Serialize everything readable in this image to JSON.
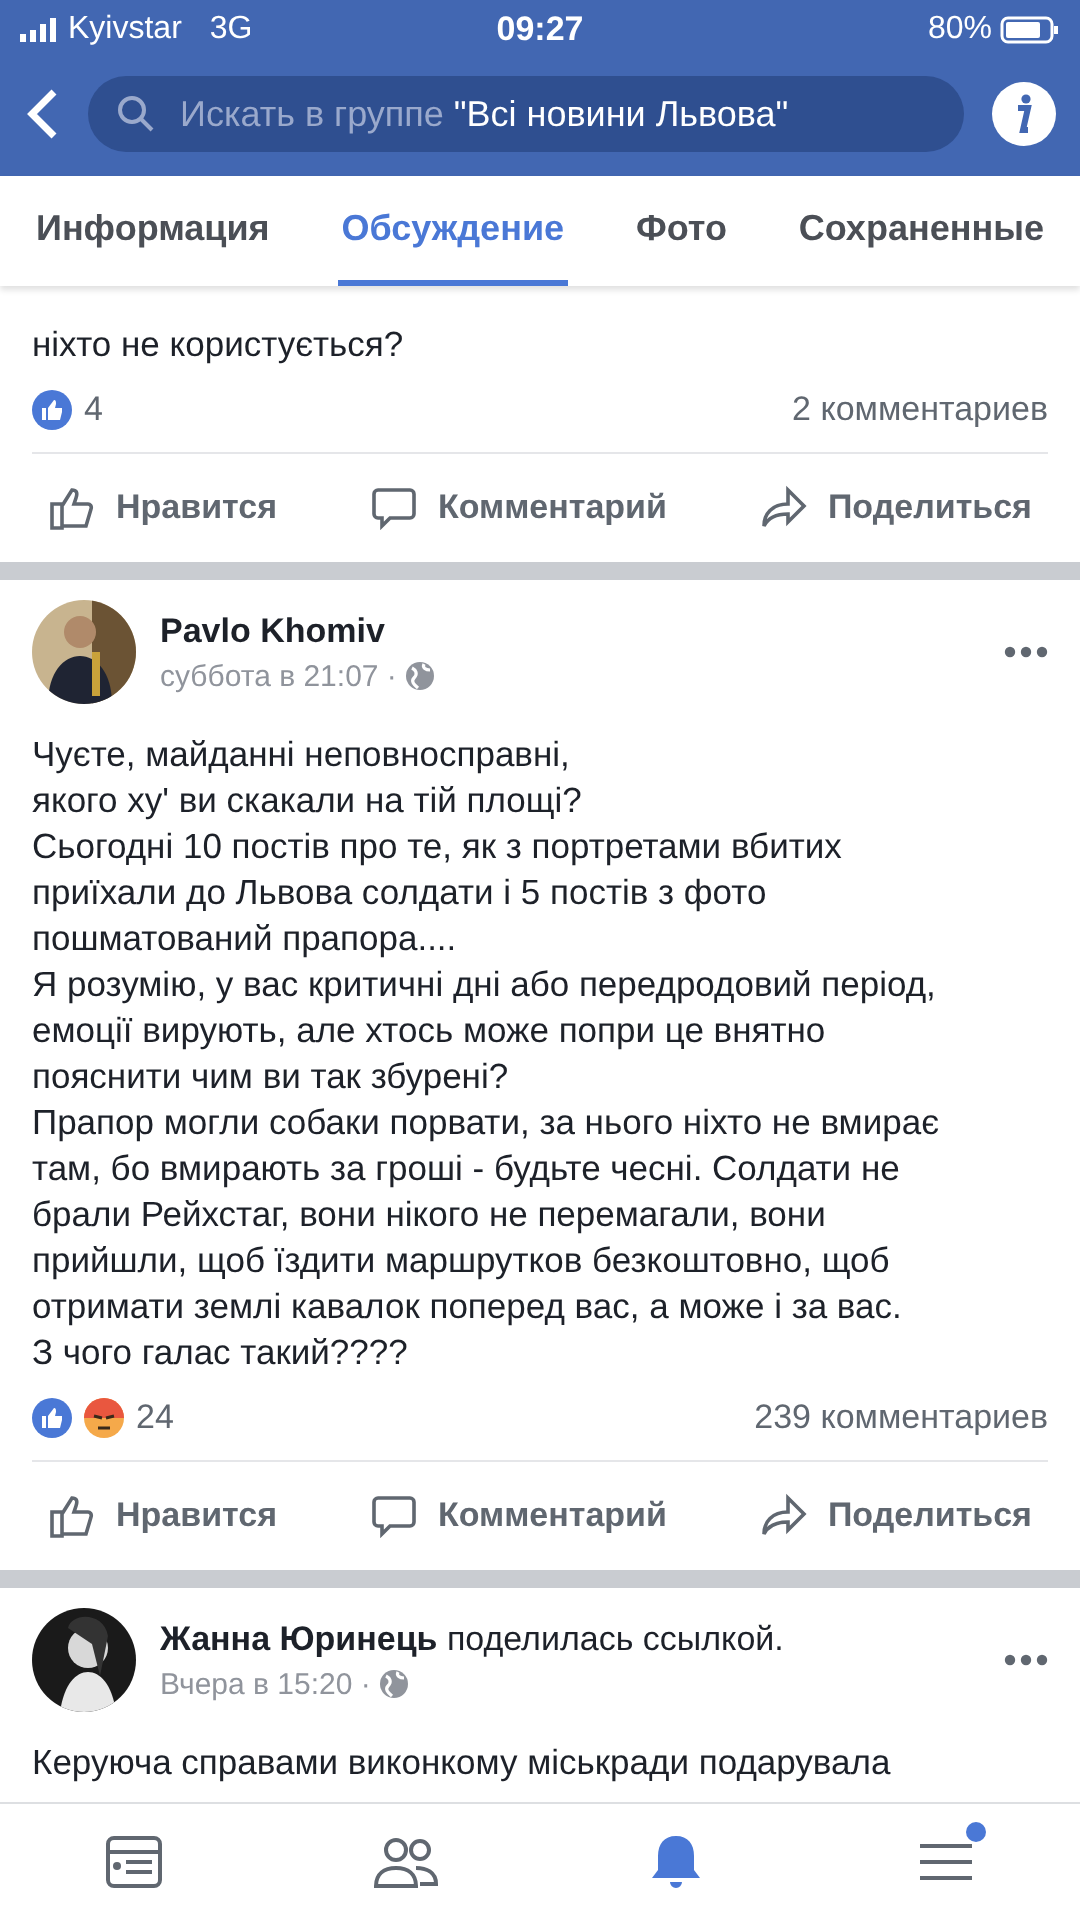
{
  "status_bar": {
    "carrier": "Kyivstar",
    "network": "3G",
    "time": "09:27",
    "battery": "80%"
  },
  "search": {
    "placeholder": "Искать в группе ",
    "group": "\"Всі новини Львова\""
  },
  "tabs": [
    {
      "label": "Информация",
      "selected": false
    },
    {
      "label": "Обсуждение",
      "selected": true
    },
    {
      "label": "Фото",
      "selected": false
    },
    {
      "label": "Сохраненные",
      "selected": false
    }
  ],
  "posts": [
    {
      "lines": [
        "ніхто не користується?"
      ],
      "reactions": [
        {
          "kind": "like"
        }
      ],
      "reaction_count": "4",
      "comments": "2 комментариев",
      "actions": [
        "Нравится",
        "Комментарий",
        "Поделиться"
      ]
    },
    {
      "author": "Pavlo Khomiv",
      "time": "суббота в 21:07 ·",
      "lines": [
        "Чуєте, майданні неповносправні,",
        "якого ху' ви скакали на тій площі?",
        "Сьогодні 10 постів про те, як з портретами вбитих",
        "приїхали до Львова солдати і 5 постів з фото",
        "пошматований прапора....",
        "Я розумію, у вас критичні дні або передродовий період,",
        "емоції вирують, але хтось може попри це внятно",
        "пояснити чим ви так збурені?",
        "Прапор могли собаки порвати, за нього ніхто не вмирає",
        "там, бо вмирають за гроші - будьте чесні. Солдати не",
        "брали Рейхстаг, вони нікого не перемагали, вони",
        "прийшли, щоб їздити маршрутков безкоштовно, щоб",
        "отримати землі кавалок поперед вас, а може і за вас.",
        "З чого галас такий????"
      ],
      "reactions": [
        {
          "kind": "like"
        },
        {
          "kind": "angry"
        }
      ],
      "reaction_count": "24",
      "comments": "239 комментариев",
      "actions": [
        "Нравится",
        "Комментарий",
        "Поделиться"
      ]
    },
    {
      "author": "Жанна Юринець",
      "author_note": "поделилась ссылкой.",
      "time": "Вчера в 15:20 ·",
      "lines": [
        "Керуюча справами виконкому міськради подарувала"
      ]
    }
  ],
  "bottom_nav": [
    {
      "selected": false,
      "badge": false
    },
    {
      "selected": false,
      "badge": false
    },
    {
      "selected": true,
      "badge": false
    },
    {
      "selected": false,
      "badge": true
    }
  ]
}
